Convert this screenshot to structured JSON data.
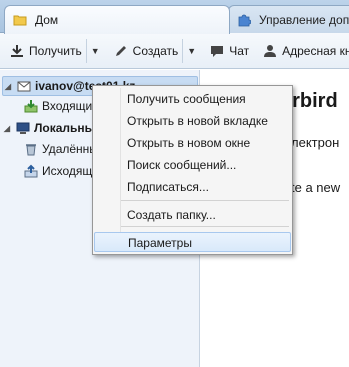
{
  "tabs": [
    {
      "label": "Дом",
      "icon": "folder-icon"
    },
    {
      "label": "Управление допо",
      "icon": "puzzle-icon"
    }
  ],
  "toolbar": {
    "get_label": "Получить",
    "create_label": "Создать",
    "chat_label": "Чат",
    "addressbook_label": "Адресная кн"
  },
  "folders": {
    "account": "ivanov@test01.kz",
    "inbox": "Входящие",
    "local": "Локальны",
    "trash": "Удалённы",
    "outbox": "Исходящ"
  },
  "content": {
    "brand": "erbird",
    "line1": "лектрон",
    "line2": "te a new"
  },
  "context_menu": {
    "items": [
      "Получить сообщения",
      "Открыть в новой вкладке",
      "Открыть в новом окне",
      "Поиск сообщений...",
      "Подписаться...",
      "Создать папку...",
      "Параметры"
    ]
  },
  "colors": {
    "accent": "#3a78c8",
    "selection": "#c7dcf3",
    "menu_hover": "#d9e9fa"
  }
}
